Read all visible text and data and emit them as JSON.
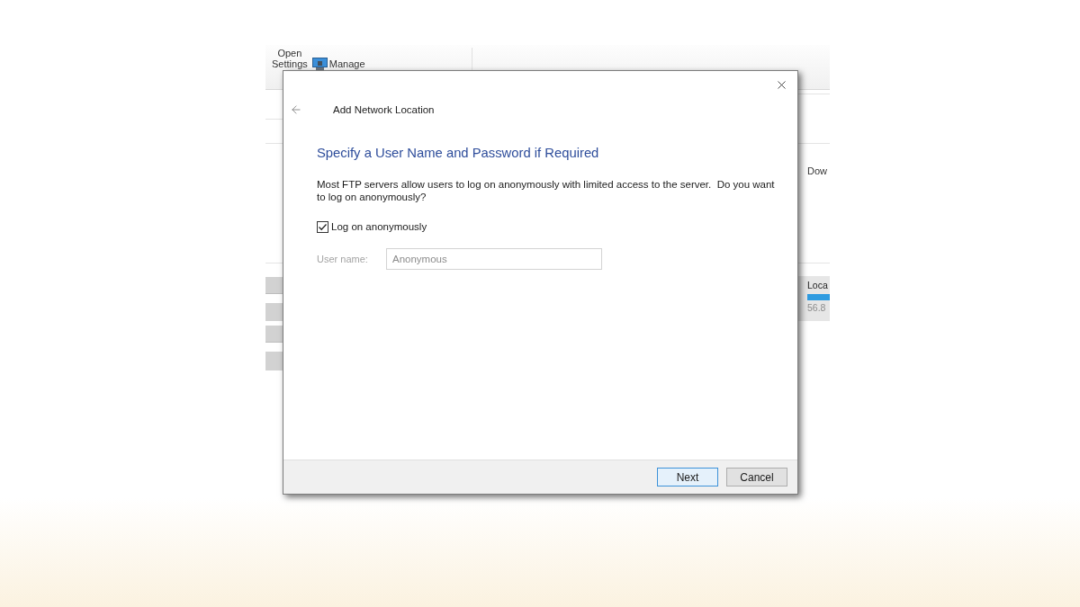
{
  "background_window": {
    "toolbar": {
      "settings_button": {
        "lines": [
          "Open",
          "Settings"
        ]
      },
      "manage_button": {
        "label": "Manage"
      }
    },
    "section_label": "Dow",
    "drive": {
      "name": "Loca",
      "reading": "56.8"
    }
  },
  "dialog": {
    "title": "Add Network Location",
    "heading": "Specify a User Name and Password if Required",
    "description": "Most FTP servers allow users to log on anonymously with limited access to the server.  Do you want to log on anonymously?",
    "anonymous_checkbox": {
      "label": "Log on anonymously",
      "checked": true
    },
    "user_name": {
      "label": "User name:",
      "value": "Anonymous",
      "disabled": true
    },
    "buttons": [
      {
        "label": "Next",
        "default": true
      },
      {
        "label": "Cancel",
        "default": false
      }
    ]
  }
}
